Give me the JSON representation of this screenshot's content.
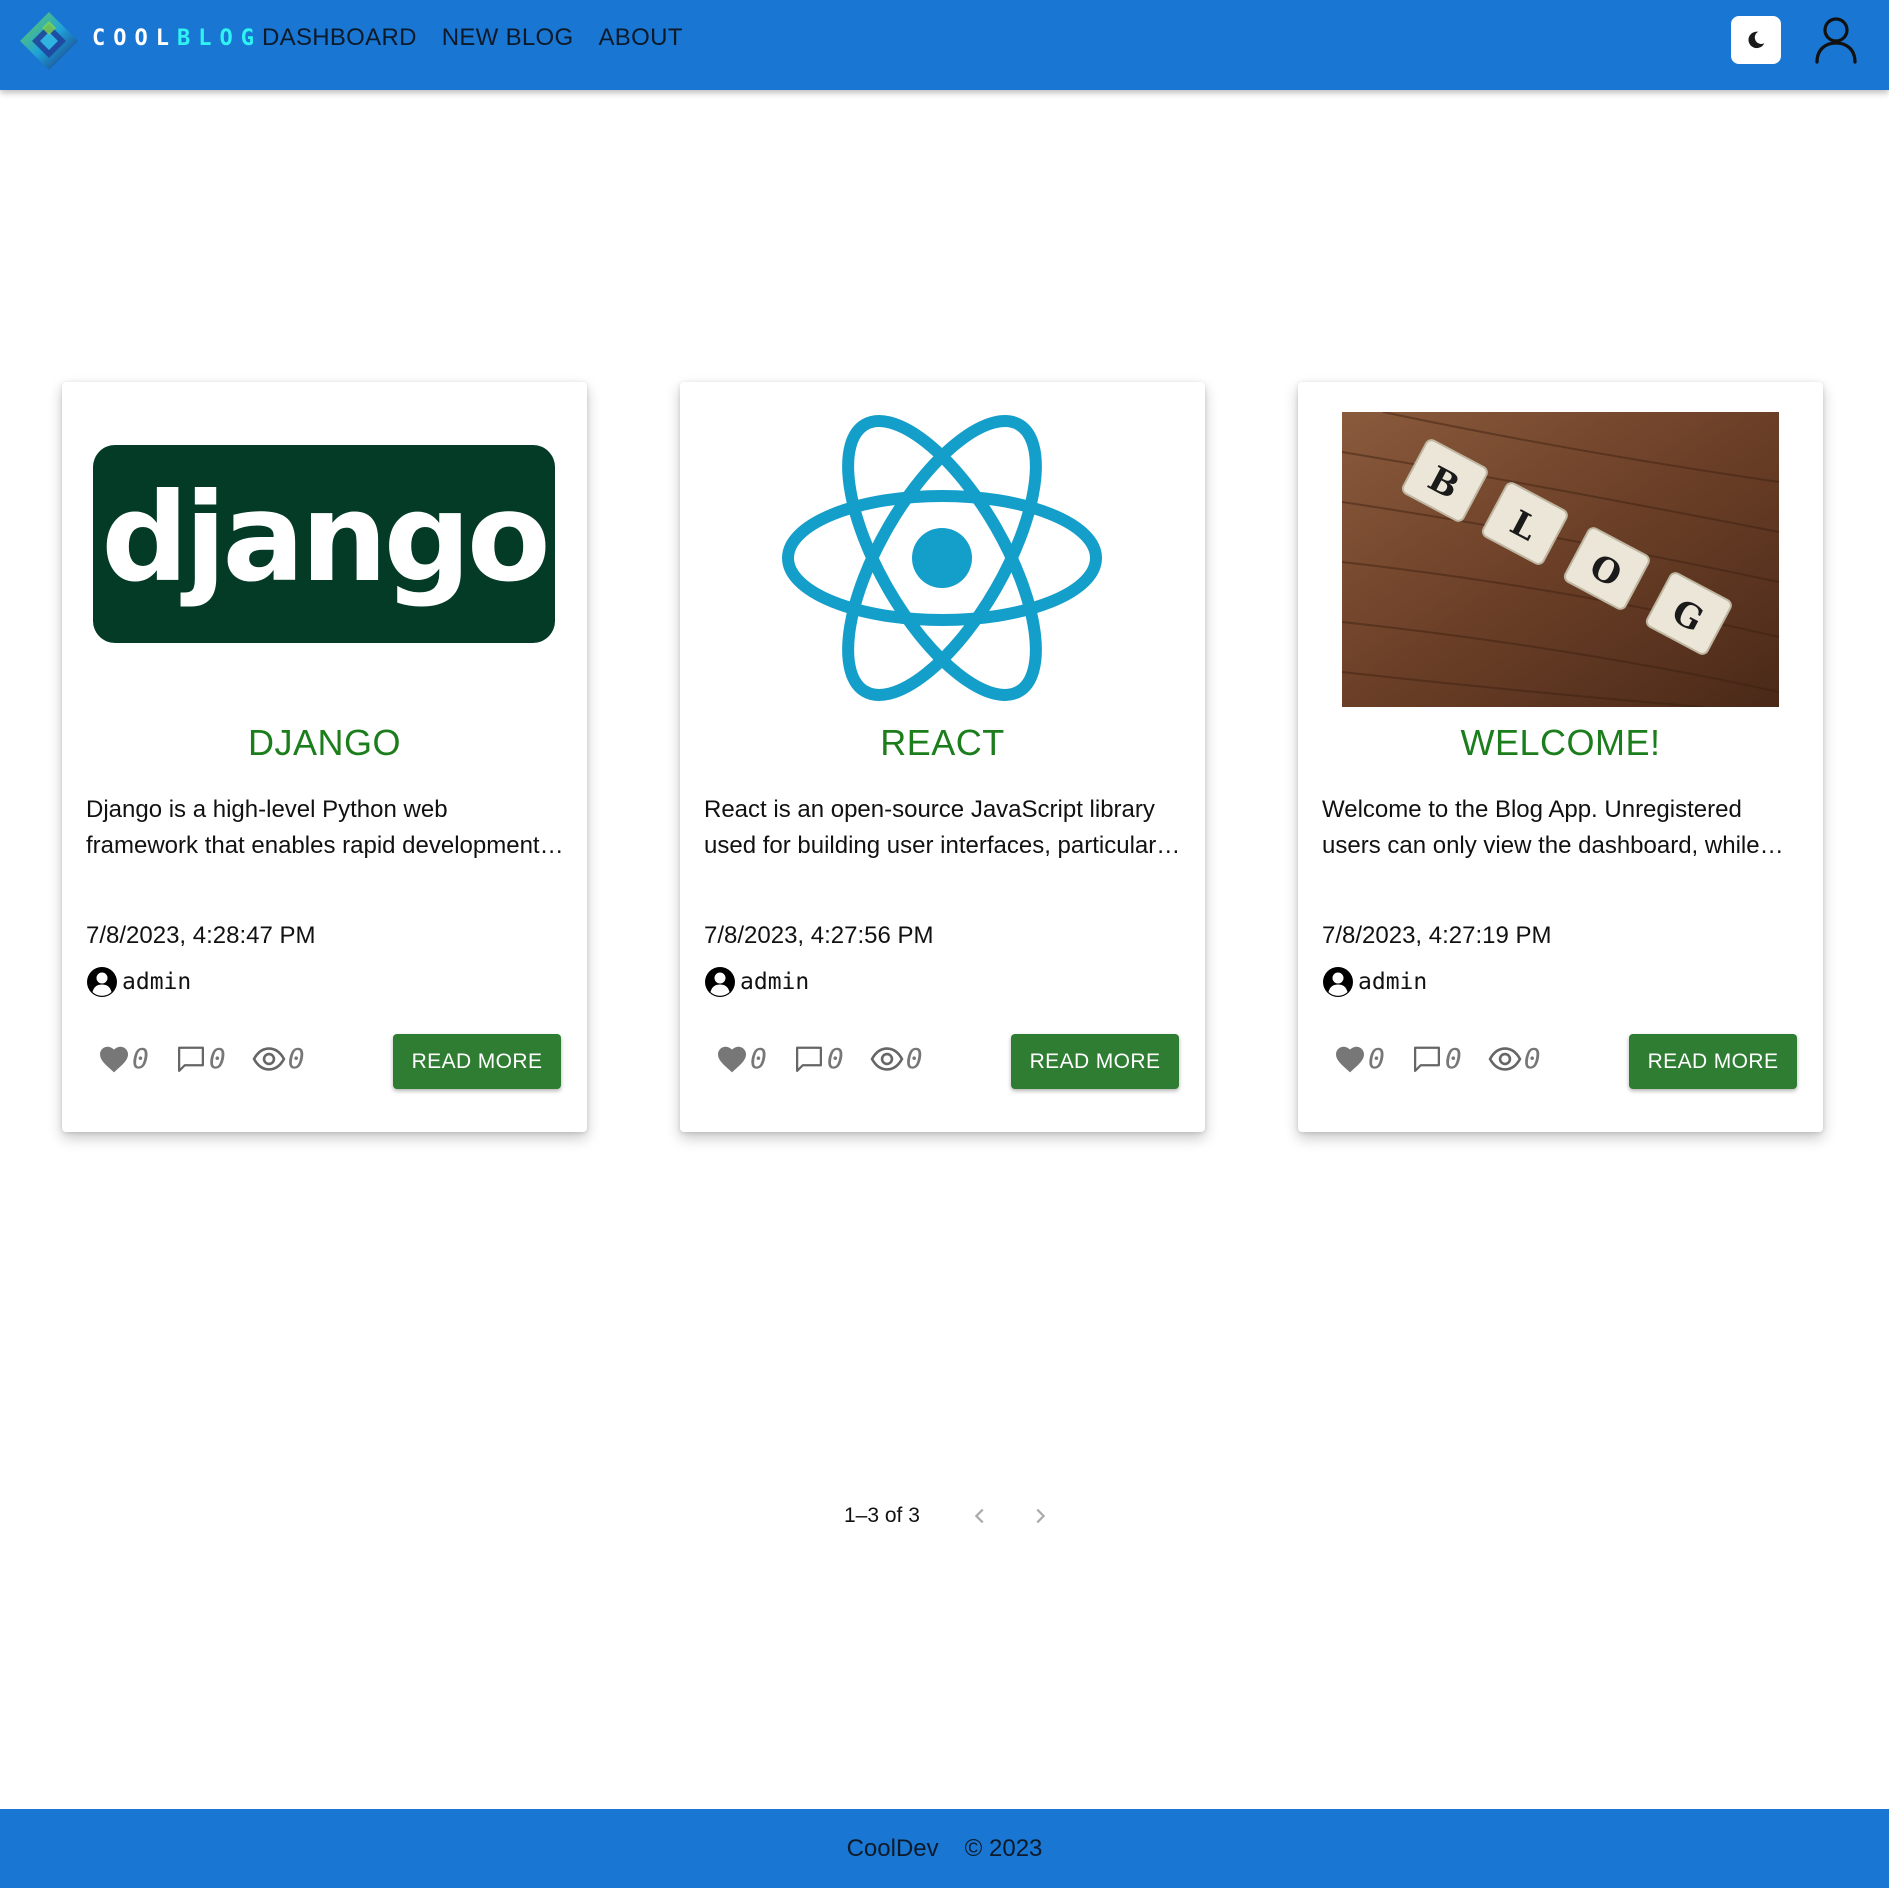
{
  "brand": {
    "part1": "COOL",
    "part2": "BLOG"
  },
  "nav": {
    "links": [
      {
        "label": "DASHBOARD"
      },
      {
        "label": "NEW BLOG"
      },
      {
        "label": "ABOUT"
      }
    ],
    "theme_icon": "moon-icon",
    "user_icon": "user-outline-icon"
  },
  "colors": {
    "primary": "#1976d2",
    "title_green": "#1b7d1b",
    "button_green": "#2e7d32",
    "brand_accent": "#2ff3f3"
  },
  "cards": [
    {
      "image_text": "django",
      "title": "DJANGO",
      "excerpt": "Django is a high-level Python web framework that enables rapid development of secure and maintainable websites.",
      "date": "7/8/2023, 4:28:47 PM",
      "author": "admin",
      "likes": "0",
      "comments": "0",
      "views": "0",
      "button": "READ MORE"
    },
    {
      "title": "REACT",
      "excerpt": "React is an open-source JavaScript library used for building user interfaces, particularly for single-page applications.",
      "date": "7/8/2023, 4:27:56 PM",
      "author": "admin",
      "likes": "0",
      "comments": "0",
      "views": "0",
      "button": "READ MORE"
    },
    {
      "image_text": [
        "B",
        "L",
        "O",
        "G"
      ],
      "title": "WELCOME!",
      "excerpt": "Welcome to the Blog App. Unregistered users can only view the dashboard, while registered users can write blogs.",
      "date": "7/8/2023, 4:27:19 PM",
      "author": "admin",
      "likes": "0",
      "comments": "0",
      "views": "0",
      "button": "READ MORE"
    }
  ],
  "pagination": {
    "label": "1–3 of 3"
  },
  "footer": {
    "company": "CoolDev",
    "copyright": "© 2023"
  }
}
